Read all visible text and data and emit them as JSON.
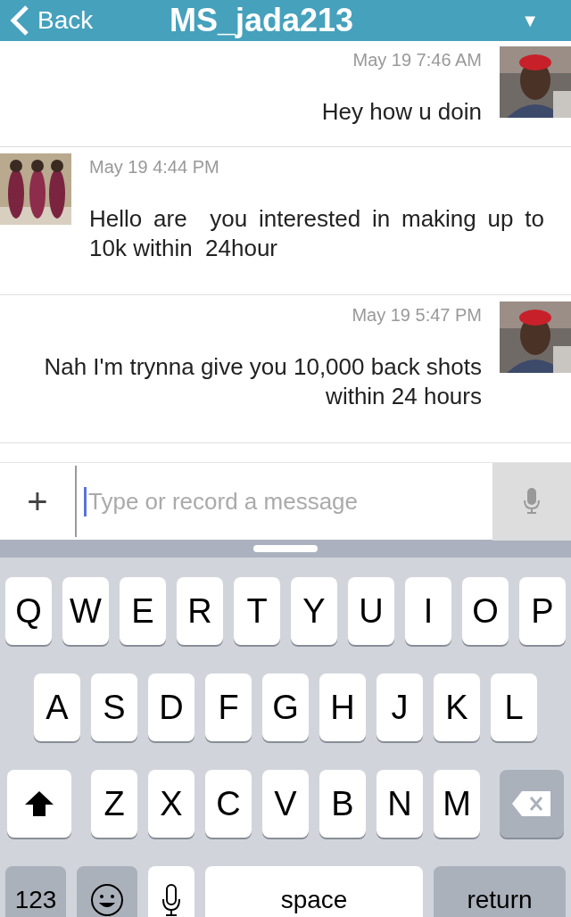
{
  "header": {
    "back": "Back",
    "title": "MS_jada213",
    "menu": "▼"
  },
  "messages": [
    {
      "kind": "sent",
      "time": "May 19 7:46 AM",
      "text": "Hey how u doin"
    },
    {
      "kind": "received",
      "time": "May 19 4:44 PM",
      "text": "Hello are  you interested in making up to 10k within  24hour"
    },
    {
      "kind": "sent",
      "time": "May 19 5:47 PM",
      "text": "Nah I'm trynna give you 10,000 back shots within 24 hours"
    }
  ],
  "composer": {
    "plus": "+",
    "placeholder": "Type or record a message"
  },
  "keyboard": {
    "rows": [
      {
        "keys": [
          {
            "kind": "letter",
            "label": "Q"
          },
          {
            "kind": "letter",
            "label": "W"
          },
          {
            "kind": "letter",
            "label": "E"
          },
          {
            "kind": "letter",
            "label": "R"
          },
          {
            "kind": "letter",
            "label": "T"
          },
          {
            "kind": "letter",
            "label": "Y"
          },
          {
            "kind": "letter",
            "label": "U"
          },
          {
            "kind": "letter",
            "label": "I"
          },
          {
            "kind": "letter",
            "label": "O"
          },
          {
            "kind": "letter",
            "label": "P"
          }
        ]
      },
      {
        "keys": [
          {
            "kind": "letter",
            "label": "A"
          },
          {
            "kind": "letter",
            "label": "S"
          },
          {
            "kind": "letter",
            "label": "D"
          },
          {
            "kind": "letter",
            "label": "F"
          },
          {
            "kind": "letter",
            "label": "G"
          },
          {
            "kind": "letter",
            "label": "H"
          },
          {
            "kind": "letter",
            "label": "J"
          },
          {
            "kind": "letter",
            "label": "K"
          },
          {
            "kind": "letter",
            "label": "L"
          }
        ]
      },
      {
        "keys": [
          {
            "kind": "shift"
          },
          {
            "kind": "letter",
            "label": "Z"
          },
          {
            "kind": "letter",
            "label": "X"
          },
          {
            "kind": "letter",
            "label": "C"
          },
          {
            "kind": "letter",
            "label": "V"
          },
          {
            "kind": "letter",
            "label": "B"
          },
          {
            "kind": "letter",
            "label": "N"
          },
          {
            "kind": "letter",
            "label": "M"
          },
          {
            "kind": "delete"
          }
        ]
      },
      {
        "keys": [
          {
            "kind": "numbers",
            "label": "123"
          },
          {
            "kind": "emoji"
          },
          {
            "kind": "dictation"
          },
          {
            "kind": "space",
            "label": "space"
          },
          {
            "kind": "return",
            "label": "return"
          }
        ]
      }
    ]
  }
}
